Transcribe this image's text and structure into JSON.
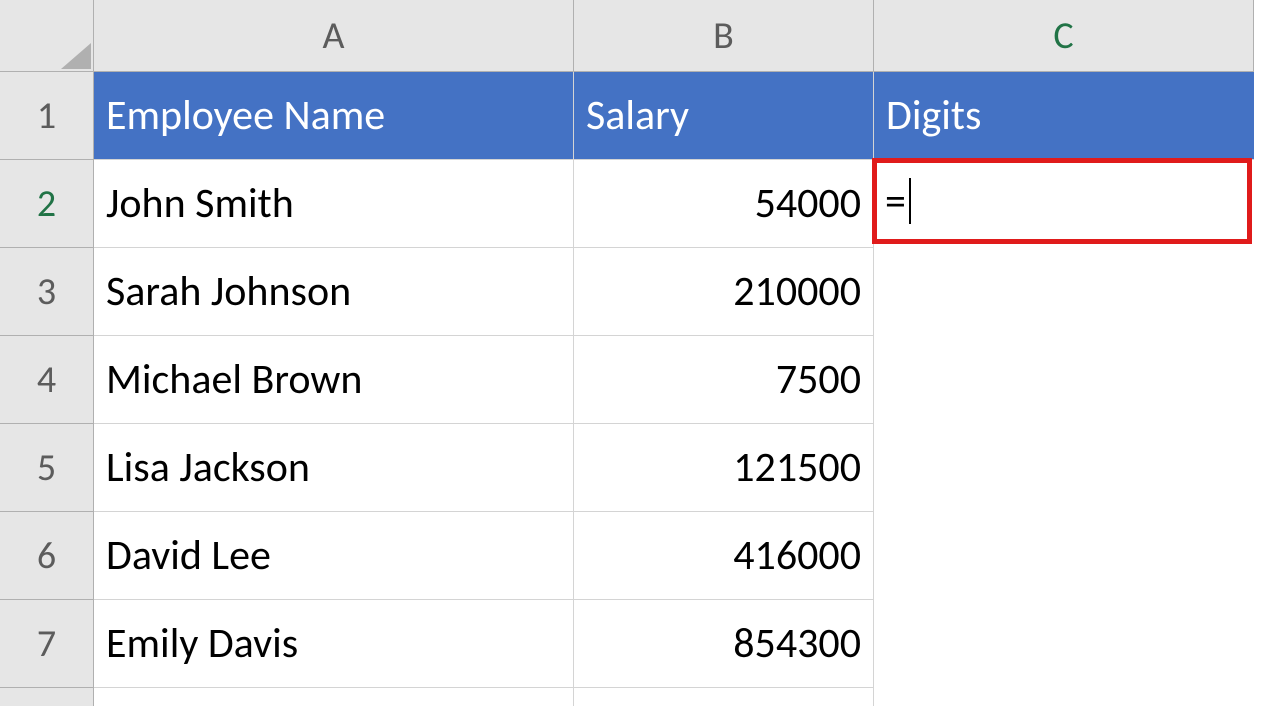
{
  "columns": {
    "A": "A",
    "B": "B",
    "C": "C"
  },
  "rows": {
    "1": "1",
    "2": "2",
    "3": "3",
    "4": "4",
    "5": "5",
    "6": "6",
    "7": "7"
  },
  "headers": {
    "A1": "Employee Name",
    "B1": "Salary",
    "C1": "Digits"
  },
  "data": {
    "A2": "John Smith",
    "B2": "54000",
    "C2": "=",
    "A3": "Sarah Johnson",
    "B3": "210000",
    "A4": "Michael Brown",
    "B4": "7500",
    "A5": "Lisa Jackson",
    "B5": "121500",
    "A6": "David Lee",
    "B6": "416000",
    "A7": "Emily Davis",
    "B7": "854300"
  },
  "active_cell": "C2"
}
